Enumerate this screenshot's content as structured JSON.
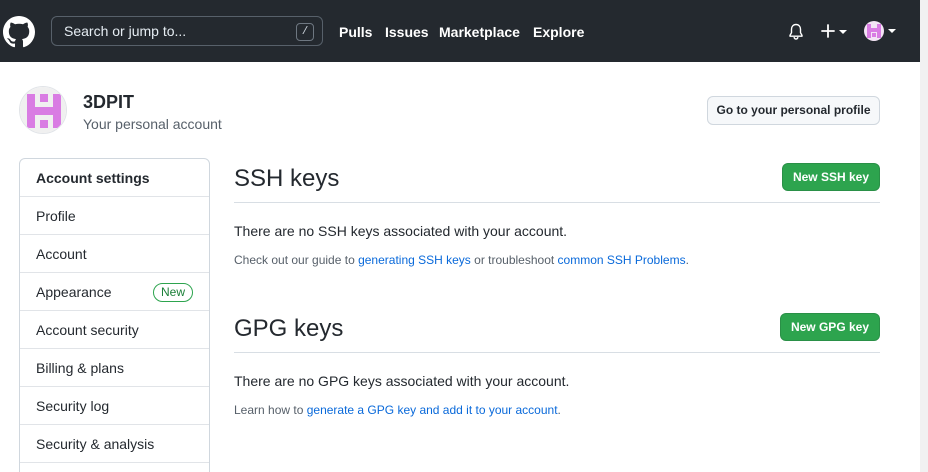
{
  "header": {
    "search_placeholder": "Search or jump to...",
    "search_shortcut": "/",
    "nav": [
      "Pulls",
      "Issues",
      "Marketplace",
      "Explore"
    ]
  },
  "profile": {
    "username": "3DPIT",
    "subtitle": "Your personal account",
    "profile_button": "Go to your personal profile"
  },
  "sidebar": {
    "heading": "Account settings",
    "items": [
      {
        "label": "Profile"
      },
      {
        "label": "Account"
      },
      {
        "label": "Appearance",
        "badge": "New"
      },
      {
        "label": "Account security"
      },
      {
        "label": "Billing & plans"
      },
      {
        "label": "Security log"
      },
      {
        "label": "Security & analysis"
      }
    ]
  },
  "ssh": {
    "title": "SSH keys",
    "button": "New SSH key",
    "empty_text": "There are no SSH keys associated with your account.",
    "help_prefix": "Check out our guide to ",
    "help_link1": "generating SSH keys",
    "help_middle": " or troubleshoot ",
    "help_link2": "common SSH Problems",
    "help_suffix": "."
  },
  "gpg": {
    "title": "GPG keys",
    "button": "New GPG key",
    "empty_text": "There are no GPG keys associated with your account.",
    "help_prefix": "Learn how to ",
    "help_link": "generate a GPG key and add it to your account",
    "help_suffix": "."
  },
  "colors": {
    "header_bg": "#24292f",
    "primary_green": "#2da44e",
    "link_blue": "#0969da",
    "avatar_pink": "#d97ce3"
  }
}
